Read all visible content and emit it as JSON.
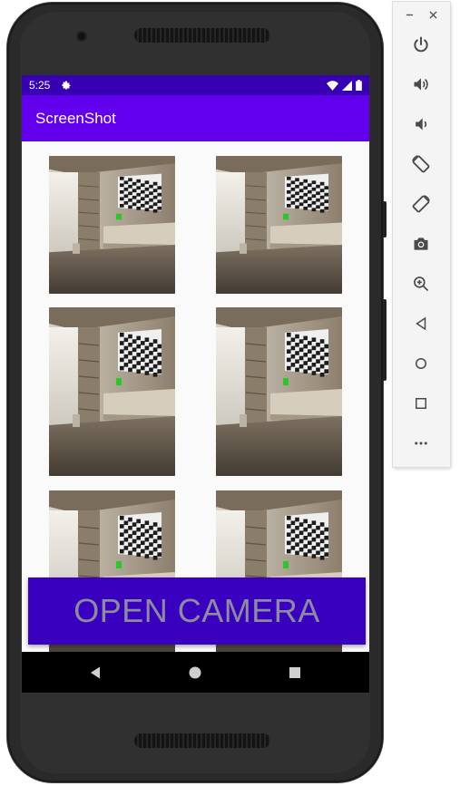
{
  "status_bar": {
    "time": "5:25",
    "icons": [
      "gear-icon",
      "wifi-icon",
      "signal-icon",
      "battery-icon"
    ]
  },
  "app_bar": {
    "title": "ScreenShot"
  },
  "gallery": {
    "items": [
      {
        "alt": "room screenshot 1"
      },
      {
        "alt": "room screenshot 2"
      },
      {
        "alt": "room screenshot 3"
      },
      {
        "alt": "room screenshot 4"
      },
      {
        "alt": "room screenshot 5"
      },
      {
        "alt": "room screenshot 6"
      }
    ]
  },
  "open_camera_label": "OPEN CAMERA",
  "nav_bar": {
    "buttons": [
      "back-icon",
      "home-icon",
      "recents-icon"
    ]
  },
  "toolbar": {
    "window_controls": [
      "minimize-icon",
      "close-icon"
    ],
    "buttons": [
      "power-icon",
      "volume-up-icon",
      "volume-down-icon",
      "rotate-left-icon",
      "rotate-right-icon",
      "camera-icon",
      "zoom-icon",
      "back-icon",
      "home-icon",
      "overview-icon",
      "more-icon"
    ]
  },
  "colors": {
    "status_bar": "#3700b3",
    "app_bar": "#6200ee",
    "button": "#3a00c0",
    "button_text": "#8c8c9c"
  }
}
